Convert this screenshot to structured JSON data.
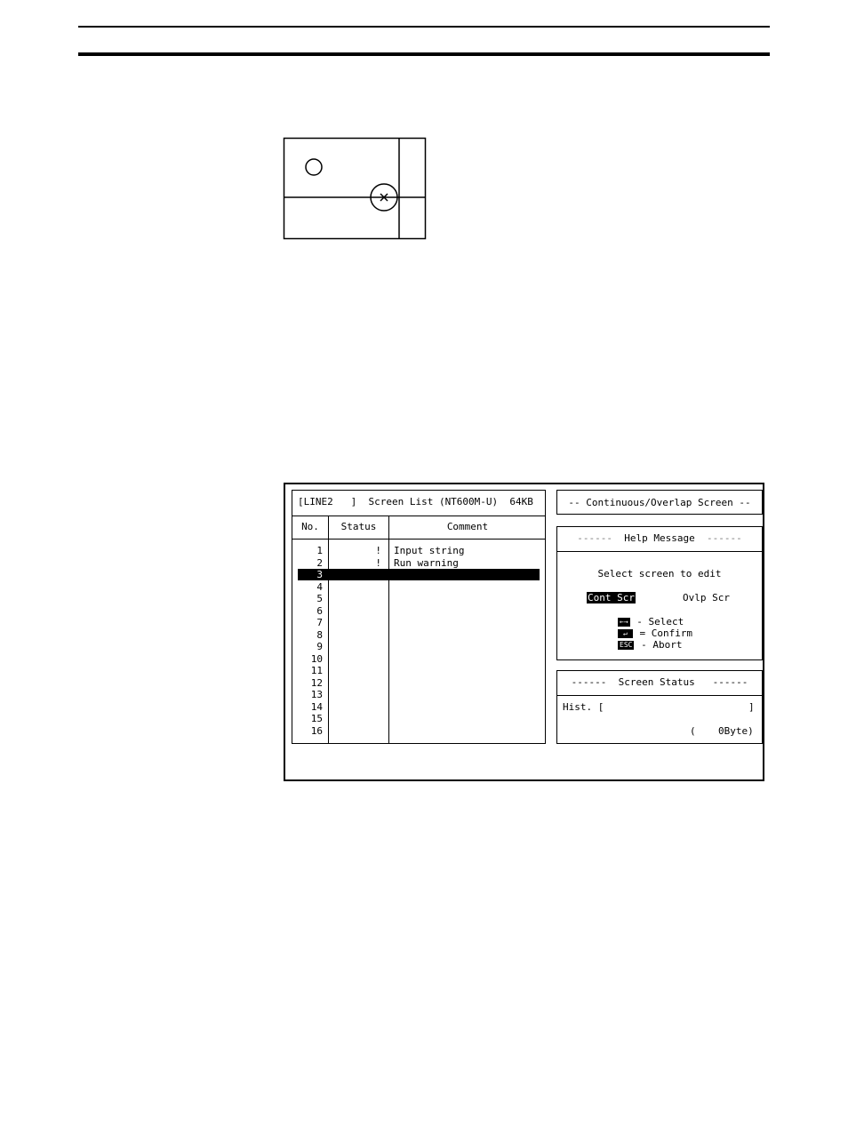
{
  "diagram": {},
  "screen": {
    "list": {
      "title": "[LINE2   ]  Screen List (NT600M-U)  64KB",
      "headers": {
        "no": "No.",
        "status": "Status",
        "comment": "Comment"
      },
      "rows": [
        {
          "no": "1",
          "status": "!",
          "comment": "Input string"
        },
        {
          "no": "2",
          "status": "!",
          "comment": "Run warning"
        },
        {
          "no": "3",
          "status": "",
          "comment": ""
        },
        {
          "no": "4",
          "status": "",
          "comment": ""
        },
        {
          "no": "5",
          "status": "",
          "comment": ""
        },
        {
          "no": "6",
          "status": "",
          "comment": ""
        },
        {
          "no": "7",
          "status": "",
          "comment": ""
        },
        {
          "no": "8",
          "status": "",
          "comment": ""
        },
        {
          "no": "9",
          "status": "",
          "comment": ""
        },
        {
          "no": "10",
          "status": "",
          "comment": ""
        },
        {
          "no": "11",
          "status": "",
          "comment": ""
        },
        {
          "no": "12",
          "status": "",
          "comment": ""
        },
        {
          "no": "13",
          "status": "",
          "comment": ""
        },
        {
          "no": "14",
          "status": "",
          "comment": ""
        },
        {
          "no": "15",
          "status": "",
          "comment": ""
        },
        {
          "no": "16",
          "status": "",
          "comment": ""
        }
      ],
      "selected_row": "3"
    },
    "mode": {
      "label": "-- Continuous/Overlap Screen --"
    },
    "help": {
      "title_dash_left": "------",
      "title": "Help Message",
      "title_dash_right": "------",
      "prompt": "Select screen to edit",
      "option_cont": "Cont Scr",
      "option_ovlp": "Ovlp Scr",
      "keys": [
        {
          "key": "←→",
          "action": "- Select"
        },
        {
          "key": "↵",
          "action": "= Confirm"
        },
        {
          "key": "ESC",
          "action": "- Abort"
        }
      ]
    },
    "status": {
      "title": "------  Screen Status   ------",
      "hist_label": "Hist. [",
      "hist_close": "]",
      "size_open": "(",
      "size_value": "0Byte)"
    }
  }
}
